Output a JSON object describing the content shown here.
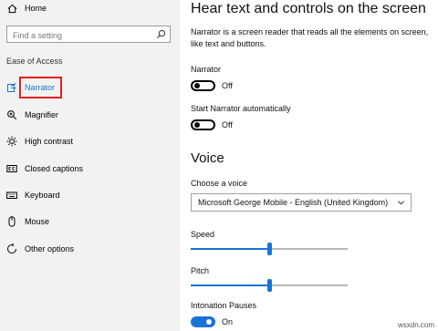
{
  "sidebar": {
    "home_label": "Home",
    "search_placeholder": "Find a setting",
    "section_label": "Ease of Access",
    "items": [
      {
        "label": "Narrator",
        "icon": "narrator-icon",
        "active": true
      },
      {
        "label": "Magnifier",
        "icon": "magnifier-icon"
      },
      {
        "label": "High contrast",
        "icon": "high-contrast-icon"
      },
      {
        "label": "Closed captions",
        "icon": "closed-captions-icon"
      },
      {
        "label": "Keyboard",
        "icon": "keyboard-icon"
      },
      {
        "label": "Mouse",
        "icon": "mouse-icon"
      },
      {
        "label": "Other options",
        "icon": "other-options-icon"
      }
    ]
  },
  "main": {
    "title": "Hear text and controls on the screen",
    "description": "Narrator is a screen reader that reads all the elements on screen, like text and buttons.",
    "narrator": {
      "label": "Narrator",
      "state": "Off",
      "on": false
    },
    "start_auto": {
      "label": "Start Narrator automatically",
      "state": "Off",
      "on": false
    },
    "voice_heading": "Voice",
    "choose_voice": {
      "label": "Choose a voice",
      "value": "Microsoft George Mobile - English (United Kingdom)"
    },
    "speed": {
      "label": "Speed",
      "value_fraction": 0.5
    },
    "pitch": {
      "label": "Pitch",
      "value_fraction": 0.5
    },
    "intonation": {
      "label": "Intonation Pauses",
      "state": "On",
      "on": true
    }
  },
  "watermark": "wsxdn.com",
  "colors": {
    "accent": "#1a73d9",
    "highlight_box": "#e5201e",
    "sidebar_bg": "#f2f2f2"
  }
}
